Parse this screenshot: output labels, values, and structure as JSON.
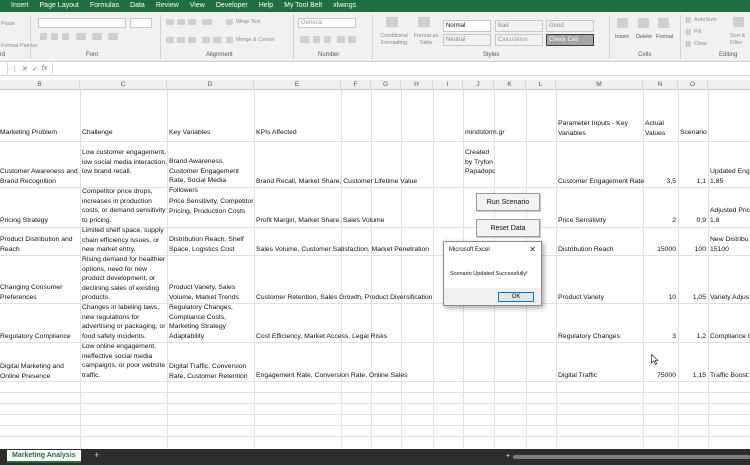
{
  "menu": [
    "Insert",
    "Page Layout",
    "Formulas",
    "Data",
    "Review",
    "View",
    "Developer",
    "Help",
    "My Tool Belt",
    "xlwings"
  ],
  "ribbon": {
    "groups": [
      "Font",
      "Alignment",
      "Number",
      "Styles",
      "Cells",
      "Editing"
    ],
    "wrap_text": "Wrap Text",
    "merge_center": "Merge & Center",
    "number_format": "General",
    "conditional_formatting": "Conditional Formatting",
    "format_as_table": "Format as Table",
    "styles": [
      {
        "label": "Normal",
        "bg": "#ffffff",
        "fg": "#111111"
      },
      {
        "label": "Bad",
        "bg": "#ffc7ce",
        "fg": "#9c0006"
      },
      {
        "label": "Good",
        "bg": "#c6efce",
        "fg": "#006100"
      },
      {
        "label": "Neutral",
        "bg": "#ffeb9c",
        "fg": "#9c6500"
      },
      {
        "label": "Calculation",
        "bg": "#f2f2f2",
        "fg": "#fa7d00"
      },
      {
        "label": "Check Cell",
        "bg": "#a5a5a5",
        "fg": "#ffffff"
      }
    ],
    "insert": "Insert",
    "delete": "Delete",
    "format": "Format",
    "autosum": "AutoSum",
    "fill": "Fill",
    "clear": "Clear",
    "sort_filter": "Sort & Filter",
    "paste_fragment": "Paste",
    "format_painter_fragment": "Format Painter",
    "clipboard_fragment": "rd"
  },
  "columns": [
    "B",
    "C",
    "D",
    "E",
    "F",
    "G",
    "H",
    "I",
    "J",
    "K",
    "L",
    "M",
    "N",
    "O"
  ],
  "headers": {
    "b": "Marketing Problem",
    "c": "Challenge",
    "d": "Key Variables",
    "e": "KPIs Affected",
    "j": "mindstorm.gr",
    "m": "Parameter Inputs - Key Variables",
    "n": "Actual Values",
    "o": "Scenario"
  },
  "credit": "Created by Tryfon Papadopoulos",
  "rows": [
    {
      "b": "Customer Awareness and Brand Recognition",
      "c": "Low customer engagement, low social media interaction, low brand recall.",
      "d": "Brand Awareness, Customer Engagement Rate, Social Media Followers",
      "e": "Brand Recall, Market Share, Customer Lifetime Value",
      "m": "Customer Engagement Rate",
      "n": "3,5",
      "o": "1,1",
      "p": "1,85",
      "p2": "Updated Enga"
    },
    {
      "b": "Pricing Strategy",
      "c": "Competitor price drops, increases in production costs, or demand sensitivity to pricing.",
      "d": "Price Sensitivity, Competitor Pricing, Production Costs",
      "e": "Profit Margin, Market Share, Sales Volume",
      "m": "Price Sensitivity",
      "n": "2",
      "o": "0,9",
      "p": "1,8",
      "p2": "Adjusted Pric"
    },
    {
      "b": "Product Distribution and Reach",
      "c": "Limited shelf space, supply chain efficiency issues, or new market entry.",
      "d": "Distribution Reach, Shelf Space, Logistics Cost",
      "e": "Sales Volume, Customer Satisfaction, Market Penetration",
      "m": "Distribution Reach",
      "n": "15000",
      "o": "100",
      "p": "15100",
      "p2": "New Distribu"
    },
    {
      "b": "Changing Consumer Preferences",
      "c": "Rising demand for healthier options, need for new product development, or declining sales of existing products.",
      "d": "Product Variety, Sales Volume, Market Trends",
      "e": "Customer Retention, Sales Growth, Product Diversification",
      "m": "Product Variety",
      "n": "10",
      "o": "1,05",
      "p": "Variety Adjus"
    },
    {
      "b": "Regulatory Compliance",
      "c": "Changes in labeling laws, new regulations for advertising or packaging, or food safety incidents.",
      "d": "Regulatory Changes, Compliance Costs, Marketing Strategy Adaptability",
      "e": "Cost Efficiency, Market Access, Legal Risks",
      "m": "Regulatory Changes",
      "n": "3",
      "o": "1,2",
      "p": "Compliance C"
    },
    {
      "b": "Digital Marketing and Online Presence",
      "c": "Low online engagement, ineffective social media campaigns, or poor website traffic.",
      "d": "Digital Traffic, Conversion Rate, Customer Retention",
      "e": "Engagement Rate, Conversion Rate, Online Sales",
      "m": "Digital Traffic",
      "n": "75000",
      "o": "1,15",
      "p": "Traffic Boost:"
    }
  ],
  "buttons": {
    "run": "Run Scenario",
    "reset": "Reset Data"
  },
  "dialog": {
    "title": "Microsoft Excel",
    "message": "Scenario Updated Successfully!",
    "ok": "OK"
  },
  "sheet_tab": "Marketing Analysis",
  "add_sheet": "+"
}
